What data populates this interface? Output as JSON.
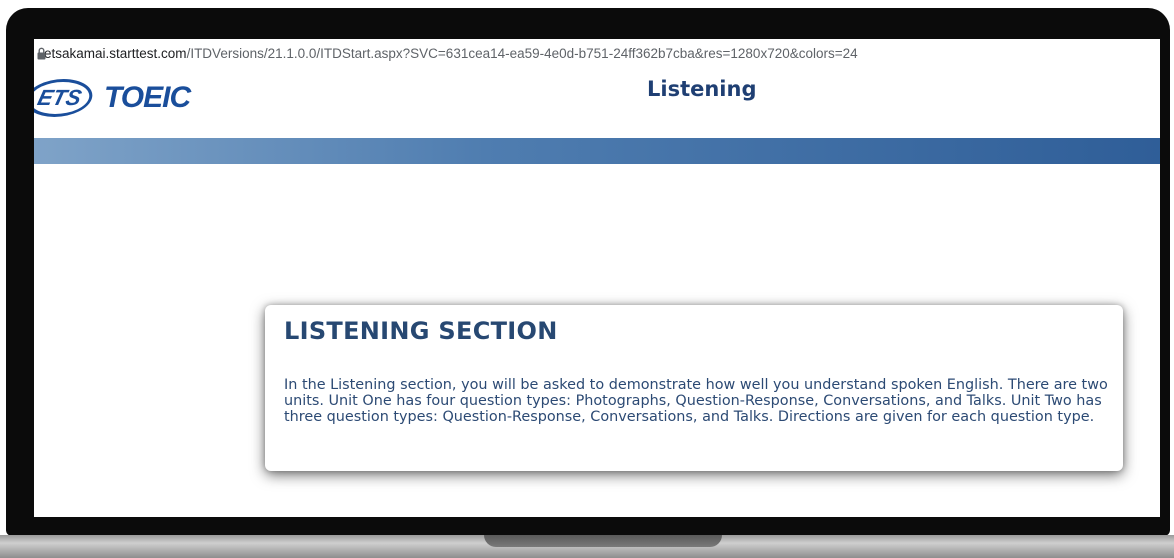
{
  "browser": {
    "url_domain": "etsakamai.starttest.com",
    "url_path": "/ITDVersions/21.1.0.0/ITDStart.aspx?SVC=631cea14-ea59-4e0d-b751-24ff362b7cba&res=1280x720&colors=24",
    "lock_icon": "lock-icon"
  },
  "header": {
    "logo_ets": "ETS",
    "logo_toeic": "TOEIC",
    "title": "Listening"
  },
  "section": {
    "title": "LISTENING SECTION",
    "body": "In the Listening section, you will be asked to demonstrate how well you understand spoken English. There are two units. Unit One has four question types: Photographs, Question-Response, Conversations, and Talks. Unit Two has three question types: Question-Response, Conversations, and Talks. Directions are given for each question type."
  },
  "colors": {
    "brand_blue": "#1a4e9b",
    "title_navy": "#274872",
    "bar_gradient_start": "#7fa3c8",
    "bar_gradient_end": "#2f5e98"
  }
}
